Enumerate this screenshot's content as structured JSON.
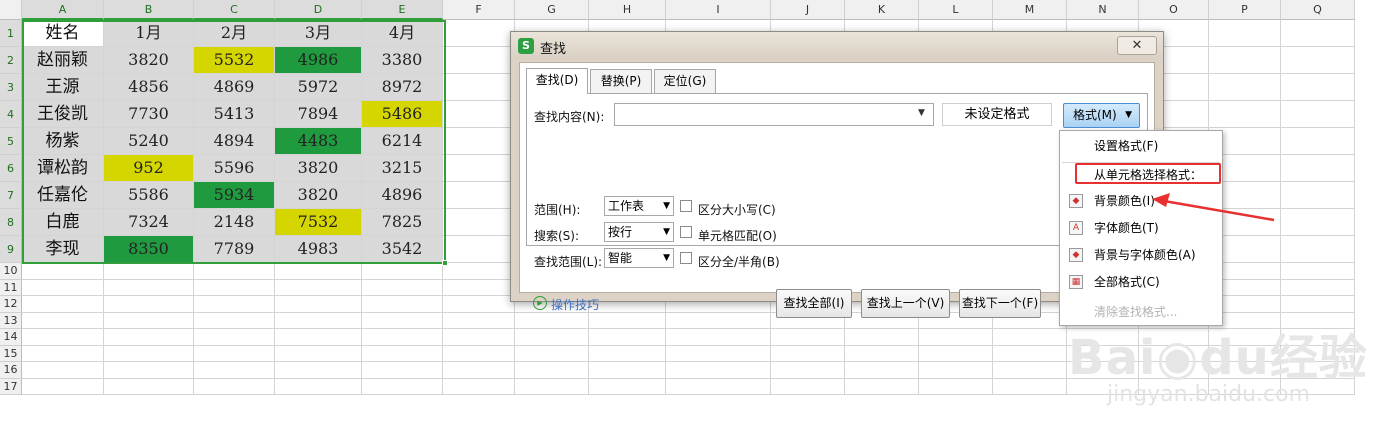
{
  "sheet": {
    "columns": [
      "A",
      "B",
      "C",
      "D",
      "E",
      "F",
      "G",
      "H",
      "I",
      "J",
      "K",
      "L",
      "M",
      "N",
      "O",
      "P",
      "Q"
    ],
    "rows": [
      "1",
      "2",
      "3",
      "4",
      "5",
      "6",
      "7",
      "8",
      "9",
      "10",
      "11",
      "12",
      "13",
      "14",
      "15",
      "16",
      "17"
    ],
    "table": [
      [
        "姓名",
        "1月",
        "2月",
        "3月",
        "4月"
      ],
      [
        "赵丽颖",
        "3820",
        "5532",
        "4986",
        "3380"
      ],
      [
        "王源",
        "4856",
        "4869",
        "5972",
        "8972"
      ],
      [
        "王俊凯",
        "7730",
        "5413",
        "7894",
        "5486"
      ],
      [
        "杨紫",
        "5240",
        "4894",
        "4483",
        "6214"
      ],
      [
        "谭松韵",
        "952",
        "5596",
        "3820",
        "3215"
      ],
      [
        "任嘉伦",
        "5586",
        "5934",
        "3820",
        "4896"
      ],
      [
        "白鹿",
        "7324",
        "2148",
        "7532",
        "7825"
      ],
      [
        "李现",
        "8350",
        "7789",
        "4983",
        "3542"
      ]
    ],
    "cell_fills": [
      [
        "#ffffff",
        "#d9d9d9",
        "#d9d9d9",
        "#d9d9d9",
        "#d9d9d9"
      ],
      [
        "#d9d9d9",
        "#d9d9d9",
        "#d5d600",
        "#1f9a3f",
        "#d9d9d9"
      ],
      [
        "#d9d9d9",
        "#d9d9d9",
        "#d9d9d9",
        "#d9d9d9",
        "#d9d9d9"
      ],
      [
        "#d9d9d9",
        "#d9d9d9",
        "#d9d9d9",
        "#d9d9d9",
        "#d5d600"
      ],
      [
        "#d9d9d9",
        "#d9d9d9",
        "#d9d9d9",
        "#1f9a3f",
        "#d9d9d9"
      ],
      [
        "#d9d9d9",
        "#d5d600",
        "#d9d9d9",
        "#d9d9d9",
        "#d9d9d9"
      ],
      [
        "#d9d9d9",
        "#d9d9d9",
        "#1f9a3f",
        "#d9d9d9",
        "#d9d9d9"
      ],
      [
        "#d9d9d9",
        "#d9d9d9",
        "#d9d9d9",
        "#d5d600",
        "#d9d9d9"
      ],
      [
        "#d9d9d9",
        "#1f9a3f",
        "#d9d9d9",
        "#d9d9d9",
        "#d9d9d9"
      ]
    ],
    "selection_color": "#2f9e3b"
  },
  "dialog": {
    "title": "查找",
    "app_icon": "S",
    "close_icon": "✕",
    "tabs": [
      {
        "label": "查找(D)",
        "active": true
      },
      {
        "label": "替换(P)",
        "active": false
      },
      {
        "label": "定位(G)",
        "active": false
      }
    ],
    "find_label": "查找内容(N):",
    "find_value": "",
    "format_state": "未设定格式",
    "format_button": "格式(M)",
    "scope_label": "范围(H):",
    "scope_value": "工作表",
    "search_label": "搜索(S):",
    "search_value": "按行",
    "lookin_label": "查找范围(L):",
    "lookin_value": "智能",
    "match_case": "区分大小写(C)",
    "match_cell": "单元格匹配(O)",
    "match_width": "区分全/半角(B)",
    "tips": "操作技巧",
    "find_all": "查找全部(I)",
    "find_prev": "查找上一个(V)",
    "find_next": "查找下一个(F)"
  },
  "menu": {
    "set_format": "设置格式(F)",
    "from_cell": "从单元格选择格式：",
    "bg_color": "背景颜色(I)",
    "font_color": "字体颜色(T)",
    "bg_font_color": "背景与字体颜色(A)",
    "all_format": "全部格式(C)",
    "clear_format": "清除查找格式..."
  },
  "colors": {
    "accent_green": "#2f9e3b",
    "annotation_red": "#e83030",
    "format_button_blue": "#a9d2f4"
  }
}
